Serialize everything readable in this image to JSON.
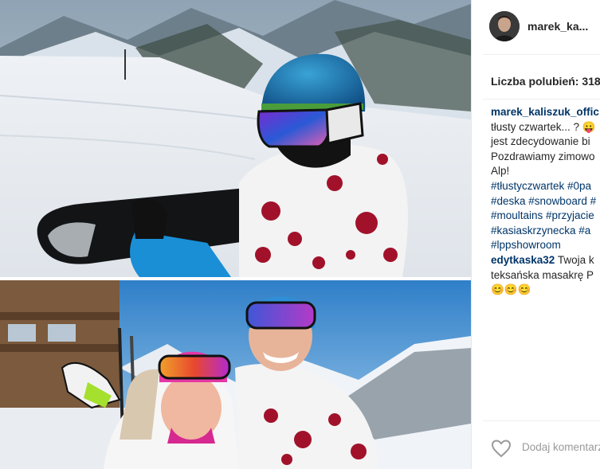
{
  "post": {
    "username": "marek_ka...",
    "likes_text": "Liczba polubień: 318",
    "caption": {
      "author": "marek_kaliszuk_offic",
      "lines": [
        "tłusty czwartek... ? 😛",
        "jest zdecydowanie bi",
        "Pozdrawiamy zimowo",
        "Alp!"
      ],
      "hashtag_lines": [
        "#tłustyczwartek #0pa",
        "#deska #snowboard #",
        "#moultains #przyjacie",
        "#kasiaskrzynecka #a",
        "#lppshowroom"
      ]
    },
    "comments": [
      {
        "author": "edytkaska32",
        "text_first": " Twoja k",
        "text_lines": [
          "teksańska masakrę P",
          "😊😊😊"
        ]
      }
    ],
    "add_comment_placeholder": "Dodaj komentarz",
    "icons": {
      "like": "heart-outline-icon",
      "avatar": "profile-avatar"
    },
    "colors": {
      "link": "#003569",
      "text": "#262626",
      "muted": "#999999"
    }
  }
}
